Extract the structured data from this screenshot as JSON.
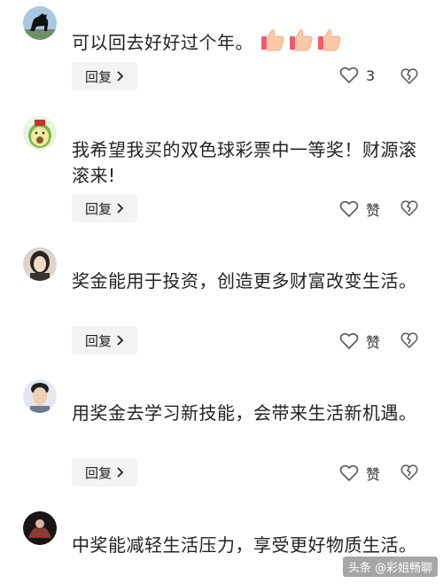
{
  "comments": [
    {
      "text": "可以回去好好过个年。",
      "emoji_icon": "thumbs-up-icon",
      "emoji_count": 3,
      "reply_label": "回复",
      "like_label": "3"
    },
    {
      "text": "我希望我买的双色球彩票中一等奖！财源滚滚来!",
      "reply_label": "回复",
      "like_label": "赞"
    },
    {
      "text": "奖金能用于投资，创造更多财富改变生活。",
      "reply_label": "回复",
      "like_label": "赞"
    },
    {
      "text": "用奖金去学习新技能，会带来生活新机遇。",
      "reply_label": "回复",
      "like_label": "赞"
    },
    {
      "text": "中奖能减轻生活压力，享受更好物质生活。"
    }
  ],
  "watermark": "头条 @彩姐畅聊",
  "colors": {
    "text": "#222222",
    "reply_bg": "#f3f3f3",
    "icon": "#555555",
    "thumb": "#f07a6a"
  }
}
